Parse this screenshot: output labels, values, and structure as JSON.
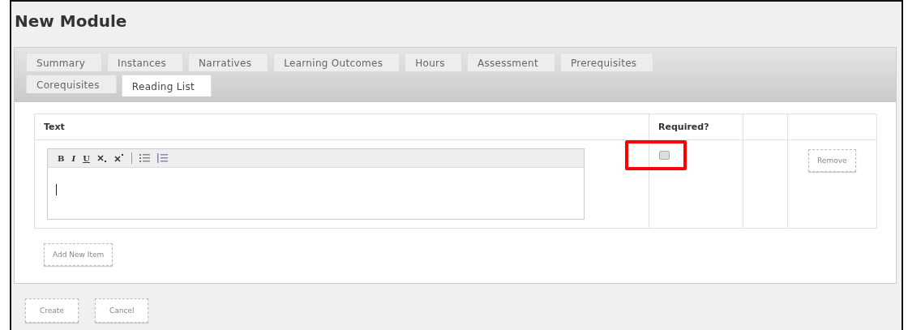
{
  "page": {
    "title": "New Module"
  },
  "tabs": [
    {
      "label": "Summary",
      "selected": false
    },
    {
      "label": "Instances",
      "selected": false
    },
    {
      "label": "Narratives",
      "selected": false
    },
    {
      "label": "Learning Outcomes",
      "selected": false
    },
    {
      "label": "Hours",
      "selected": false
    },
    {
      "label": "Assessment",
      "selected": false
    },
    {
      "label": "Prerequisites",
      "selected": false
    },
    {
      "label": "Corequisites",
      "selected": false
    },
    {
      "label": "Reading List",
      "selected": true
    }
  ],
  "table": {
    "columns": [
      "Text",
      "Required?"
    ],
    "rows": [
      {
        "toolbar": [
          {
            "kind": "bold",
            "label": "B"
          },
          {
            "kind": "italic",
            "label": "I"
          },
          {
            "kind": "underline",
            "label": "U"
          },
          {
            "kind": "subscript"
          },
          {
            "kind": "superscript"
          },
          {
            "kind": "separator"
          },
          {
            "kind": "bulleted-list"
          },
          {
            "kind": "numbered-list"
          }
        ],
        "required": false,
        "highlighted": true,
        "remove_button": "Remove"
      }
    ]
  },
  "add_button": "Add New Item",
  "buttons": [
    "Create",
    "Cancel"
  ]
}
